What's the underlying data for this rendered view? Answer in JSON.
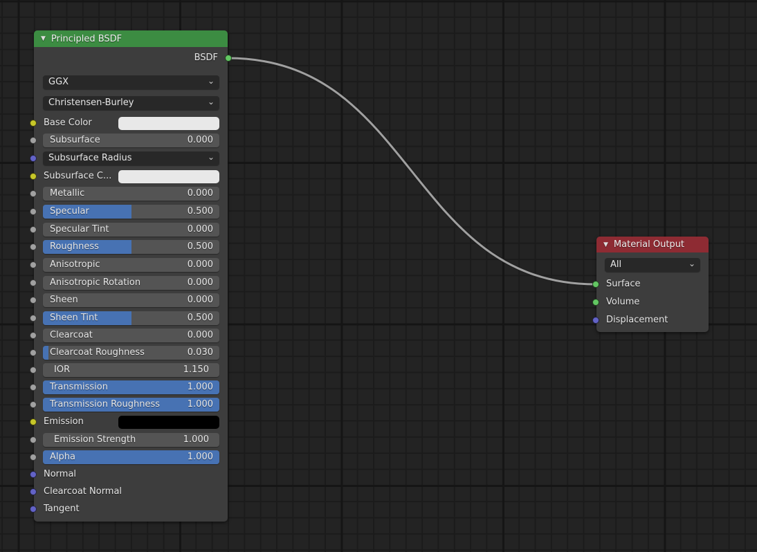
{
  "editor": {
    "type": "Shader Node Editor"
  },
  "bsdf_node": {
    "title": "Principled BSDF",
    "header_color": "#3c8c42",
    "output": {
      "label": "BSDF",
      "socket_color": "#63c763"
    },
    "distribution": "GGX",
    "subsurface_method": "Christensen-Burley",
    "inputs": [
      {
        "kind": "color",
        "label": "Base Color",
        "socket_color": "#c7c729",
        "color": "#e8e8e8"
      },
      {
        "kind": "slider",
        "label": "Subsurface",
        "value": "0.000",
        "fraction": 0.0,
        "socket_color": "#a1a1a1"
      },
      {
        "kind": "dropdown",
        "label": "Subsurface Radius",
        "socket_color": "#6363c7"
      },
      {
        "kind": "color",
        "label": "Subsurface C...",
        "socket_color": "#c7c729",
        "color": "#e8e8e8"
      },
      {
        "kind": "slider",
        "label": "Metallic",
        "value": "0.000",
        "fraction": 0.0,
        "socket_color": "#a1a1a1"
      },
      {
        "kind": "slider",
        "label": "Specular",
        "value": "0.500",
        "fraction": 0.5,
        "socket_color": "#a1a1a1"
      },
      {
        "kind": "slider",
        "label": "Specular Tint",
        "value": "0.000",
        "fraction": 0.0,
        "socket_color": "#a1a1a1"
      },
      {
        "kind": "slider",
        "label": "Roughness",
        "value": "0.500",
        "fraction": 0.5,
        "socket_color": "#a1a1a1"
      },
      {
        "kind": "slider",
        "label": "Anisotropic",
        "value": "0.000",
        "fraction": 0.0,
        "socket_color": "#a1a1a1"
      },
      {
        "kind": "slider",
        "label": "Anisotropic Rotation",
        "value": "0.000",
        "fraction": 0.0,
        "socket_color": "#a1a1a1"
      },
      {
        "kind": "slider",
        "label": "Sheen",
        "value": "0.000",
        "fraction": 0.0,
        "socket_color": "#a1a1a1"
      },
      {
        "kind": "slider",
        "label": "Sheen Tint",
        "value": "0.500",
        "fraction": 0.5,
        "socket_color": "#a1a1a1"
      },
      {
        "kind": "slider",
        "label": "Clearcoat",
        "value": "0.000",
        "fraction": 0.0,
        "socket_color": "#a1a1a1"
      },
      {
        "kind": "slider",
        "label": "Clearcoat Roughness",
        "value": "0.030",
        "fraction": 0.03,
        "socket_color": "#a1a1a1"
      },
      {
        "kind": "number",
        "label": "IOR",
        "value": "1.150",
        "socket_color": "#a1a1a1"
      },
      {
        "kind": "slider",
        "label": "Transmission",
        "value": "1.000",
        "fraction": 1.0,
        "socket_color": "#a1a1a1"
      },
      {
        "kind": "slider",
        "label": "Transmission Roughness",
        "value": "1.000",
        "fraction": 1.0,
        "socket_color": "#a1a1a1"
      },
      {
        "kind": "color",
        "label": "Emission",
        "socket_color": "#c7c729",
        "color": "#000000"
      },
      {
        "kind": "number",
        "label": "Emission Strength",
        "value": "1.000",
        "socket_color": "#a1a1a1"
      },
      {
        "kind": "slider",
        "label": "Alpha",
        "value": "1.000",
        "fraction": 1.0,
        "socket_color": "#a1a1a1"
      },
      {
        "kind": "vector",
        "label": "Normal",
        "socket_color": "#6363c7"
      },
      {
        "kind": "vector",
        "label": "Clearcoat Normal",
        "socket_color": "#6363c7"
      },
      {
        "kind": "vector",
        "label": "Tangent",
        "socket_color": "#6363c7"
      }
    ]
  },
  "output_node": {
    "title": "Material Output",
    "header_color": "#8e2b33",
    "target": "All",
    "inputs": [
      {
        "label": "Surface",
        "socket_color": "#63c763"
      },
      {
        "label": "Volume",
        "socket_color": "#63c763"
      },
      {
        "label": "Displacement",
        "socket_color": "#6363c7"
      }
    ]
  },
  "links": [
    {
      "from": "Principled BSDF.BSDF",
      "to": "Material Output.Surface"
    }
  ],
  "icons": {
    "collapse": "▼",
    "chevron": "⌄"
  }
}
